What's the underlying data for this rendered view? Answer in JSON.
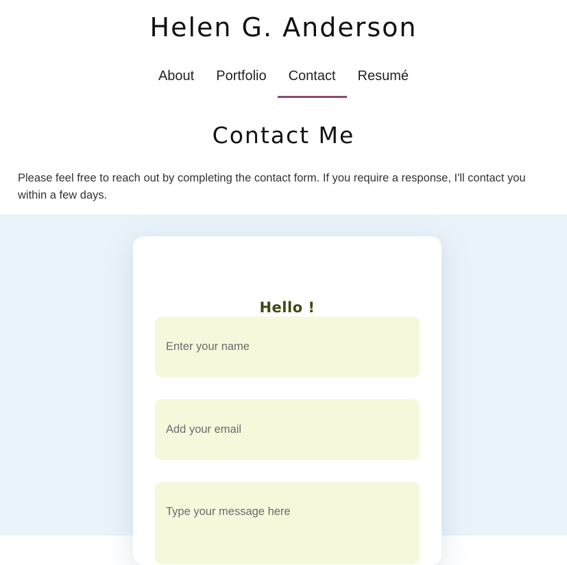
{
  "header": {
    "site_title": "Helen G. Anderson",
    "nav": [
      {
        "label": "About",
        "active": false
      },
      {
        "label": "Portfolio",
        "active": false
      },
      {
        "label": "Contact",
        "active": true
      },
      {
        "label": "Resumé",
        "active": false
      }
    ],
    "active_indicator_color": "#8a4a6e"
  },
  "main": {
    "heading": "Contact Me",
    "intro": "Please feel free to reach out by completing the contact form. If you require a response, I'll contact you within a few days."
  },
  "contact_form": {
    "title": "Hello !",
    "name_placeholder": "Enter your name",
    "email_placeholder": "Add your email",
    "message_placeholder": "Type your message here",
    "section_background": "#eaf3fa",
    "field_background": "#f6f8dc",
    "title_color": "#3d4a12"
  }
}
